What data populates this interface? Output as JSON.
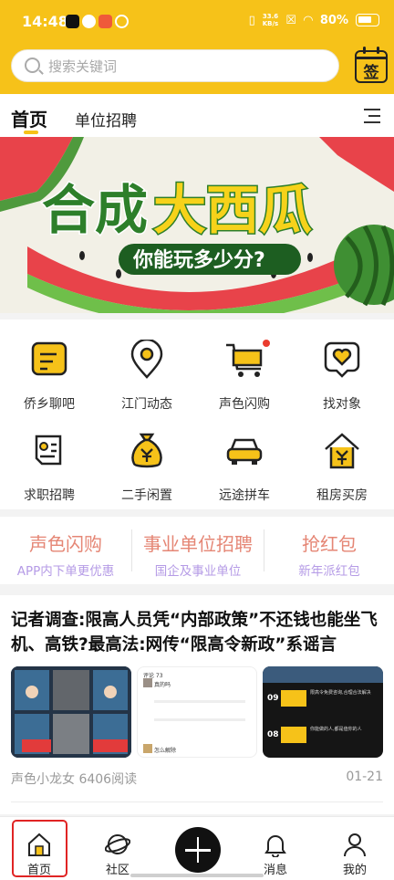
{
  "status_bar": {
    "time": "14:48",
    "net_speed_value": "33.6",
    "net_speed_unit": "KB/s",
    "battery": "80%"
  },
  "search": {
    "placeholder": "搜索关键词"
  },
  "signin": {
    "label": "签"
  },
  "tabs": {
    "home": "首页",
    "jobs": "单位招聘"
  },
  "banner": {
    "title_part1": "合成",
    "title_part2": "大西瓜",
    "subtitle": "你能玩多少分?"
  },
  "grid": {
    "items": [
      {
        "label": "侨乡聊吧",
        "icon": "chat-note-icon"
      },
      {
        "label": "江门动态",
        "icon": "location-pin-icon"
      },
      {
        "label": "声色闪购",
        "icon": "shopping-cart-icon",
        "badge": true
      },
      {
        "label": "找对象",
        "icon": "heart-chat-icon"
      },
      {
        "label": "求职招聘",
        "icon": "resume-icon"
      },
      {
        "label": "二手闲置",
        "icon": "money-bag-icon"
      },
      {
        "label": "远途拼车",
        "icon": "car-icon"
      },
      {
        "label": "租房买房",
        "icon": "house-yuan-icon"
      }
    ]
  },
  "promo": [
    {
      "title": "声色闪购",
      "subtitle": "APP内下单更优惠"
    },
    {
      "title": "事业单位招聘",
      "subtitle": "国企及事业单位"
    },
    {
      "title": "抢红包",
      "subtitle": "新年派红包"
    }
  ],
  "article": {
    "title": "记者调查:限高人员凭“内部政策”不还钱也能坐飞机、高铁?最高法:网传“限高令新政”系谣言",
    "author_views": "声色小龙女 6406阅读",
    "date": "01-21",
    "thumb2_text": {
      "comments": "评论 73",
      "reply1": "真的吗",
      "reply2": "怎么解除"
    },
    "thumb3_text": {
      "row1_time": "09",
      "row2_time": "08",
      "row1_text": "限高令免费咨询,合理合法解决",
      "row2_text": "你能做的人,都是值你的人"
    }
  },
  "bottom_nav": [
    {
      "label": "首页"
    },
    {
      "label": "社区"
    },
    {
      "label": ""
    },
    {
      "label": "消息"
    },
    {
      "label": "我的"
    }
  ],
  "colors": {
    "brand_yellow": "#f6c219",
    "promo_title": "#e58675",
    "promo_subtitle": "#b59be6",
    "highlight_red": "#e02424"
  }
}
